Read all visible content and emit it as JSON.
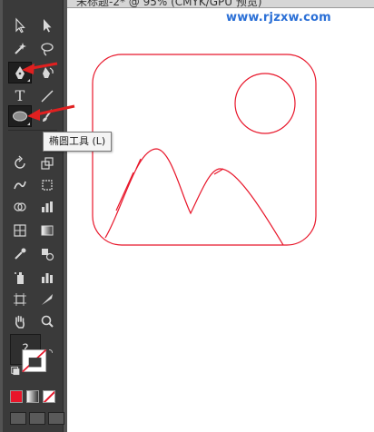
{
  "document_tab": {
    "title": "未标题-2* @ 95% (CMYK/GPU 预览)"
  },
  "watermark": {
    "text": "www.rjzxw.com"
  },
  "tooltip": {
    "text": "椭圆工具 (L)"
  },
  "toolbar": {
    "help_label": "?",
    "tools": [
      {
        "name": "selection-tool",
        "icon": "arrow-icon"
      },
      {
        "name": "direct-selection-tool",
        "icon": "hollow-arrow-icon"
      },
      {
        "name": "magic-wand-tool",
        "icon": "magic-wand-icon"
      },
      {
        "name": "lasso-tool",
        "icon": "lasso-icon"
      },
      {
        "name": "pen-tool",
        "icon": "pen-icon"
      },
      {
        "name": "curvature-tool",
        "icon": "curvature-pen-icon"
      },
      {
        "name": "type-tool",
        "icon": "type-icon",
        "glyph": "T"
      },
      {
        "name": "line-segment-tool",
        "icon": "line-icon"
      },
      {
        "name": "ellipse-tool",
        "icon": "ellipse-icon"
      },
      {
        "name": "paintbrush-tool",
        "icon": "brush-icon"
      }
    ]
  },
  "colors": {
    "stroke_accent": "#e8162a",
    "arrow": "#e02020",
    "toolbar_bg": "#3a3a3a",
    "fill_swatch": "#e8162a"
  }
}
